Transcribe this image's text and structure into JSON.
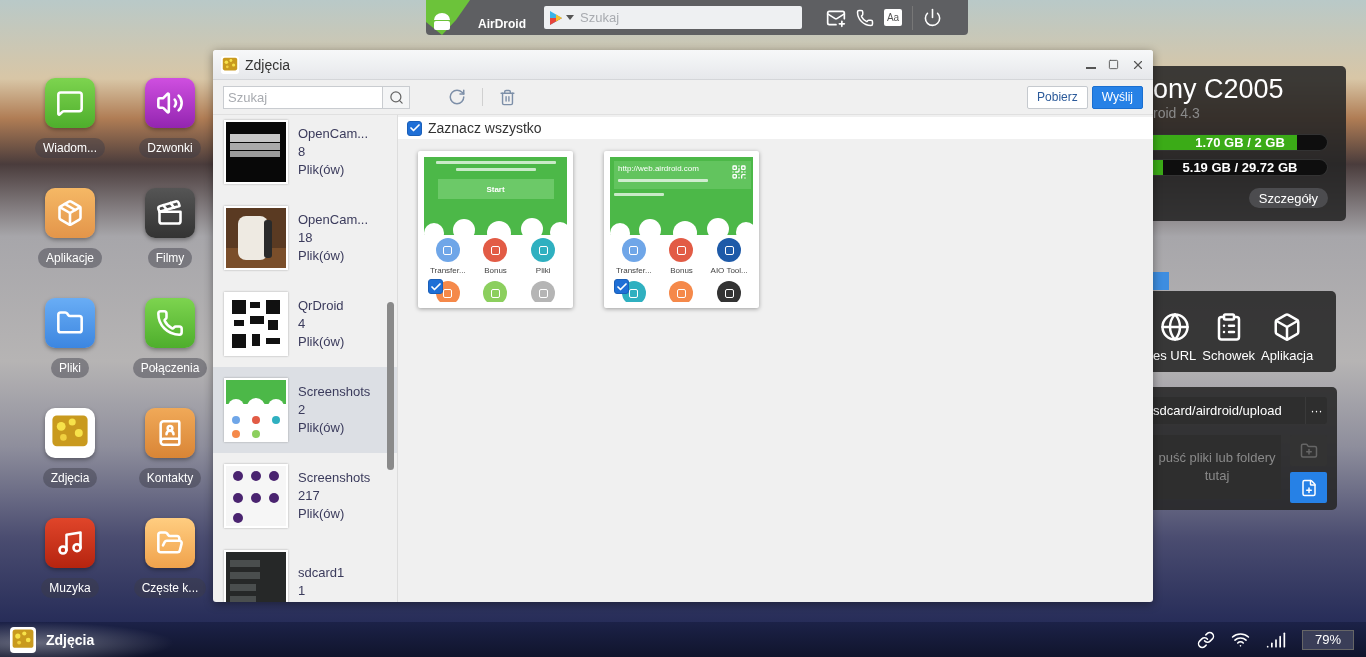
{
  "topbar": {
    "brand": "AirDroid",
    "search": {
      "placeholder": "Szukaj"
    },
    "text_icon": "Aa"
  },
  "desktop_apps": [
    {
      "label": "Wiadom...",
      "kind": "messages"
    },
    {
      "label": "Dzwonki",
      "kind": "ringtones"
    },
    {
      "label": "Aplikacje",
      "kind": "apps"
    },
    {
      "label": "Filmy",
      "kind": "videos"
    },
    {
      "label": "Pliki",
      "kind": "files"
    },
    {
      "label": "Połączenia",
      "kind": "calls"
    },
    {
      "label": "Zdjęcia",
      "kind": "photos"
    },
    {
      "label": "Kontakty",
      "kind": "contacts"
    },
    {
      "label": "Muzyka",
      "kind": "music"
    },
    {
      "label": "Częste k...",
      "kind": "frequent"
    }
  ],
  "window": {
    "title": "Zdjęcia",
    "search": {
      "placeholder": "Szukaj"
    },
    "buttons": [
      {
        "label": "Pobierz",
        "primary": false
      },
      {
        "label": "Wyślij",
        "primary": true
      }
    ],
    "albums": [
      {
        "name": "OpenCam...",
        "count": "8",
        "unit": "Plik(ów)",
        "selected": false
      },
      {
        "name": "OpenCam...",
        "count": "18",
        "unit": "Plik(ów)",
        "selected": false
      },
      {
        "name": "QrDroid",
        "count": "4",
        "unit": "Plik(ów)",
        "selected": false
      },
      {
        "name": "Screenshots",
        "count": "2",
        "unit": "Plik(ów)",
        "selected": true
      },
      {
        "name": "Screenshots",
        "count": "217",
        "unit": "Plik(ów)",
        "selected": false
      },
      {
        "name": "sdcard1",
        "count": "1",
        "selected": false
      }
    ],
    "select_all": {
      "label": "Zaznacz wszystko",
      "checked": true
    },
    "photos": [
      {
        "checked": true,
        "header": {
          "kind": "start",
          "text": "Start"
        },
        "apps": [
          {
            "label": "Transfer...",
            "color": "#6fa6e8"
          },
          {
            "label": "Bonus",
            "color": "#e25b45"
          },
          {
            "label": "Pliki",
            "color": "#2fb0c0"
          },
          {
            "color": "#f5894a"
          },
          {
            "color": "#8ccf5e"
          },
          {
            "color": "#b5b5b5"
          }
        ]
      },
      {
        "checked": true,
        "header": {
          "kind": "url",
          "text": "http://web.airdroid.com"
        },
        "apps": [
          {
            "label": "Transfer...",
            "color": "#6fa6e8"
          },
          {
            "label": "Bonus",
            "color": "#e25b45"
          },
          {
            "label": "AIO Tool...",
            "color": "#1e5aa8"
          },
          {
            "color": "#2fb0c0"
          },
          {
            "color": "#f5894a"
          },
          {
            "color": "#333333"
          }
        ]
      }
    ]
  },
  "device": {
    "name": "ony C2005",
    "os": "roid 4.3",
    "bars": [
      {
        "reading": "1.70 GB / 2 GB",
        "level": 0.83
      },
      {
        "reading": "5.19 GB / 29.72 GB",
        "level": 0.06
      }
    ],
    "details_button": "Szczegóły"
  },
  "tools": [
    {
      "label": "es URL",
      "kind": "url"
    },
    {
      "label": "Schowek",
      "kind": "clipboard"
    },
    {
      "label": "Aplikacja",
      "kind": "app"
    }
  ],
  "upload": {
    "path": "sdcard/airdroid/upload",
    "more": "···",
    "drop_lines": [
      "puść pliki lub foldery",
      "tutaj"
    ]
  },
  "taskbar": {
    "app": "Zdjęcia",
    "battery": "79%"
  }
}
